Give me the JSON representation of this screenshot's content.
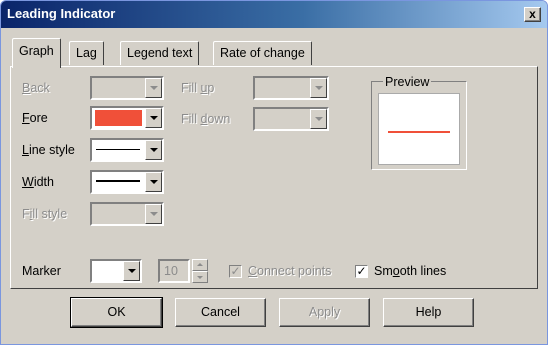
{
  "window": {
    "title": "Leading Indicator",
    "close_glyph": "x"
  },
  "tabs": [
    {
      "label": "Graph",
      "active": true
    },
    {
      "label": "Lag",
      "active": false
    },
    {
      "label": "Legend text",
      "active": false
    },
    {
      "label": "Rate of change",
      "active": false
    }
  ],
  "fields": {
    "back": {
      "label": "Back",
      "mnemonic": "B",
      "rest": "ack",
      "enabled": false
    },
    "fore": {
      "label": "Fore",
      "mnemonic": "F",
      "rest": "ore",
      "color": "#f05039",
      "enabled": true
    },
    "line_style": {
      "label": "Line style",
      "mnemonic": "L",
      "rest": "ine style",
      "enabled": true
    },
    "width": {
      "label": "Width",
      "mnemonic": "W",
      "rest": "idth",
      "enabled": true
    },
    "fill_style": {
      "label": "Fill style",
      "prefix": "F",
      "mnemonic": "i",
      "rest": "ll style",
      "enabled": false
    },
    "fill_up": {
      "label": "Fill up",
      "prefix": "Fill ",
      "mnemonic": "u",
      "rest": "p",
      "enabled": false
    },
    "fill_down": {
      "label": "Fill down",
      "prefix": "Fill ",
      "mnemonic": "d",
      "rest": "own",
      "enabled": false
    }
  },
  "preview": {
    "label": "Preview",
    "line_color": "#f05039"
  },
  "marker": {
    "label": "Marker",
    "size_value": "10",
    "connect_points": {
      "prefix": "",
      "mnemonic": "C",
      "rest": "onnect points",
      "checked": true,
      "enabled": false
    },
    "smooth_lines": {
      "prefix": "Sm",
      "mnemonic": "o",
      "rest": "oth lines",
      "checked": true,
      "enabled": true
    }
  },
  "buttons": {
    "ok": "OK",
    "cancel": "Cancel",
    "apply": "Apply",
    "help": "Help"
  },
  "colors": {
    "accent": "#0a246a",
    "face": "#d4d0c8"
  }
}
